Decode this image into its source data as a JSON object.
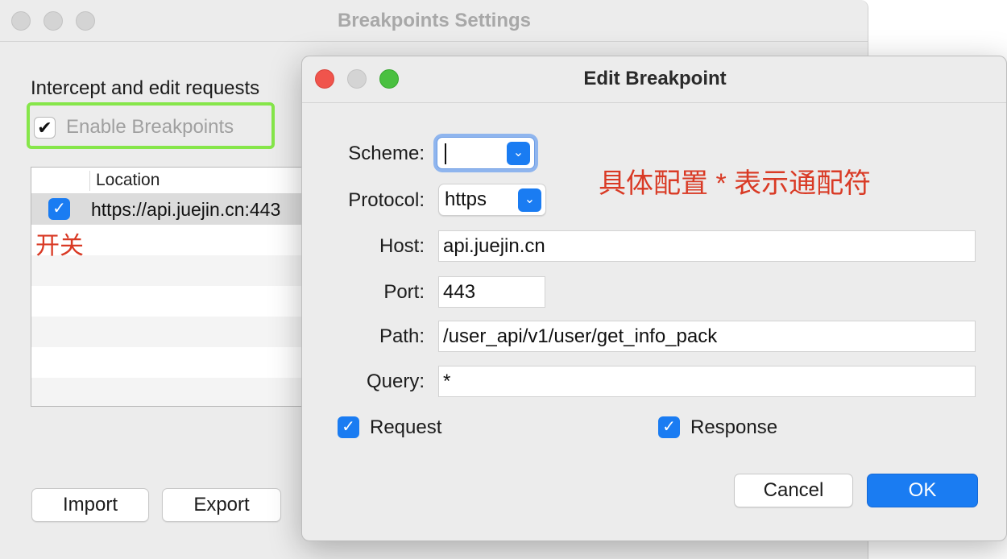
{
  "back_window": {
    "title": "Breakpoints Settings",
    "intercept_text": "Intercept and edit requests",
    "enable_label": "Enable Breakpoints",
    "enable_check": "✔",
    "table": {
      "column_header": "Location",
      "rows": [
        {
          "url": "https://api.juejin.cn:443",
          "checked": "✓"
        }
      ]
    },
    "annotation_switch": "开关",
    "buttons": {
      "import": "Import",
      "export": "Export"
    }
  },
  "dialog": {
    "title": "Edit Breakpoint",
    "fields": {
      "scheme_label": "Scheme:",
      "protocol_label": "Protocol:",
      "protocol_value": "https",
      "host_label": "Host:",
      "host_value": "api.juejin.cn",
      "port_label": "Port:",
      "port_value": "443",
      "path_label": "Path:",
      "path_value": "/user_api/v1/user/get_info_pack",
      "query_label": "Query:",
      "query_value": "*"
    },
    "dropdown_glyph": "⌄",
    "check_glyph": "✓",
    "request_label": "Request",
    "response_label": "Response",
    "annotation_config": "具体配置 * 表示通配符",
    "buttons": {
      "cancel": "Cancel",
      "ok": "OK"
    }
  },
  "colors": {
    "accent_blue": "#1a7cf2",
    "highlight_green": "#86e64a",
    "annotation_red": "#d93a25",
    "close_red": "#f0544c",
    "zoom_green": "#4ac040"
  }
}
